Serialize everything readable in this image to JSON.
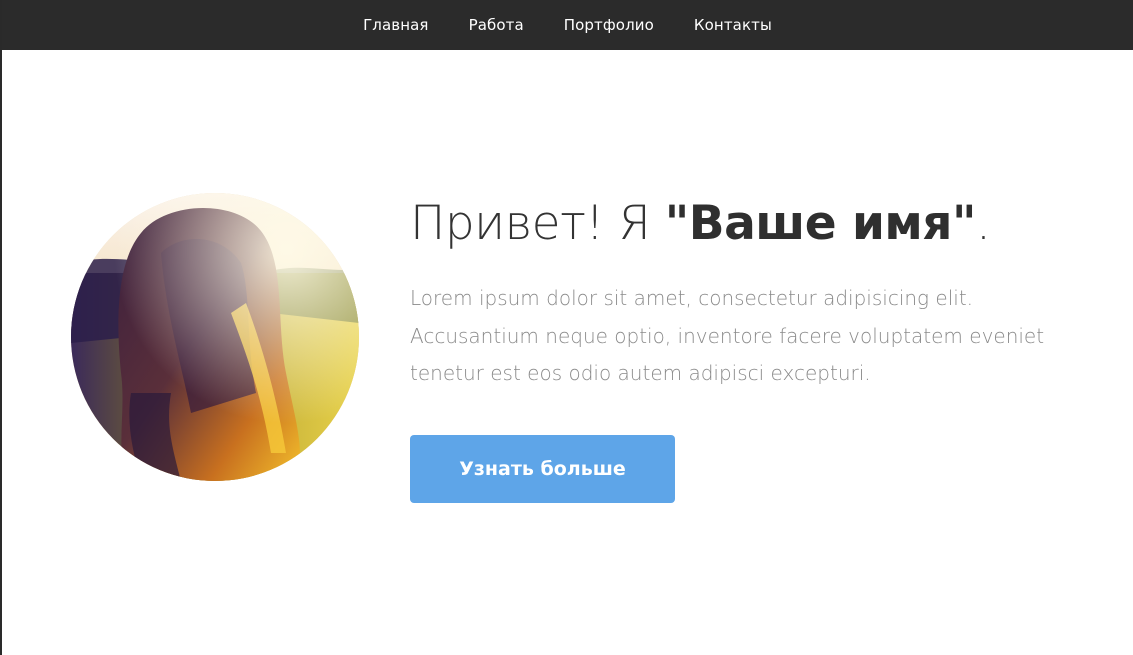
{
  "nav": {
    "items": [
      {
        "label": "Главная"
      },
      {
        "label": "Работа"
      },
      {
        "label": "Портфолио"
      },
      {
        "label": "Контакты"
      }
    ]
  },
  "hero": {
    "greeting": "Привет! Я ",
    "name": "\"Ваше имя\"",
    "period": ".",
    "description": "Lorem ipsum dolor sit amet, consectetur adipisicing elit. Accusantium neque optio, inventore facere voluptatem eveniet tenetur est eos odio autem adipisci excepturi.",
    "button_label": "Узнать больше"
  },
  "colors": {
    "nav_background": "#2b2b2b",
    "button_background": "#5ea5e8",
    "heading_text": "#333333",
    "body_text": "#8a8a8a"
  }
}
